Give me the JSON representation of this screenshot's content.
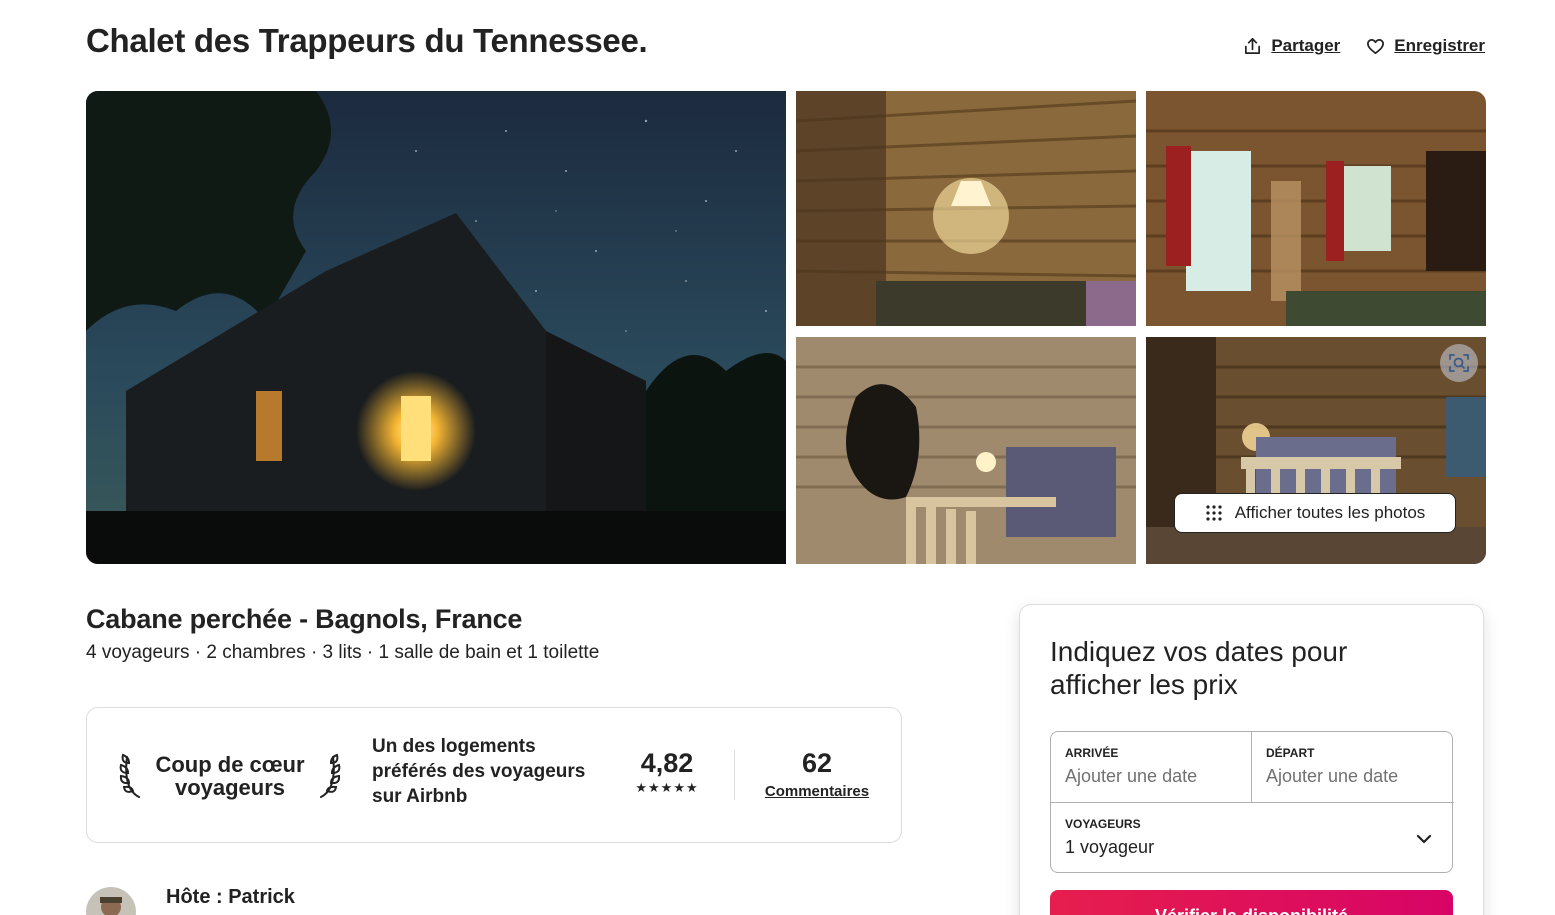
{
  "listing": {
    "title": "Chalet des Trappeurs du Tennessee."
  },
  "header_actions": {
    "share_label": "Partager",
    "save_label": "Enregistrer"
  },
  "gallery": {
    "show_all_label": "Afficher toutes les photos"
  },
  "summary": {
    "subtitle": "Cabane perchée - Bagnols, France",
    "details": "4 voyageurs · 2 chambres · 3 lits · 1 salle de bain et 1 toilette"
  },
  "guest_favorite": {
    "badge_line1": "Coup de cœur",
    "badge_line2": "voyageurs",
    "description": "Un des logements préférés des voyageurs sur Airbnb",
    "rating": "4,82",
    "stars": "★★★★★",
    "review_count": "62",
    "reviews_label": "Commentaires"
  },
  "host": {
    "label": "Hôte : Patrick"
  },
  "booking": {
    "heading": "Indiquez vos dates pour afficher les prix",
    "checkin_label": "ARRIVÉE",
    "checkin_placeholder": "Ajouter une date",
    "checkout_label": "DÉPART",
    "checkout_placeholder": "Ajouter une date",
    "guests_label": "VOYAGEURS",
    "guests_value": "1 voyageur",
    "cta_label": "Vérifier la disponibilité"
  },
  "colors": {
    "text": "#222222",
    "muted": "#717171",
    "border": "#dddddd",
    "cta_start": "#e61e4d",
    "cta_end": "#d70466"
  }
}
